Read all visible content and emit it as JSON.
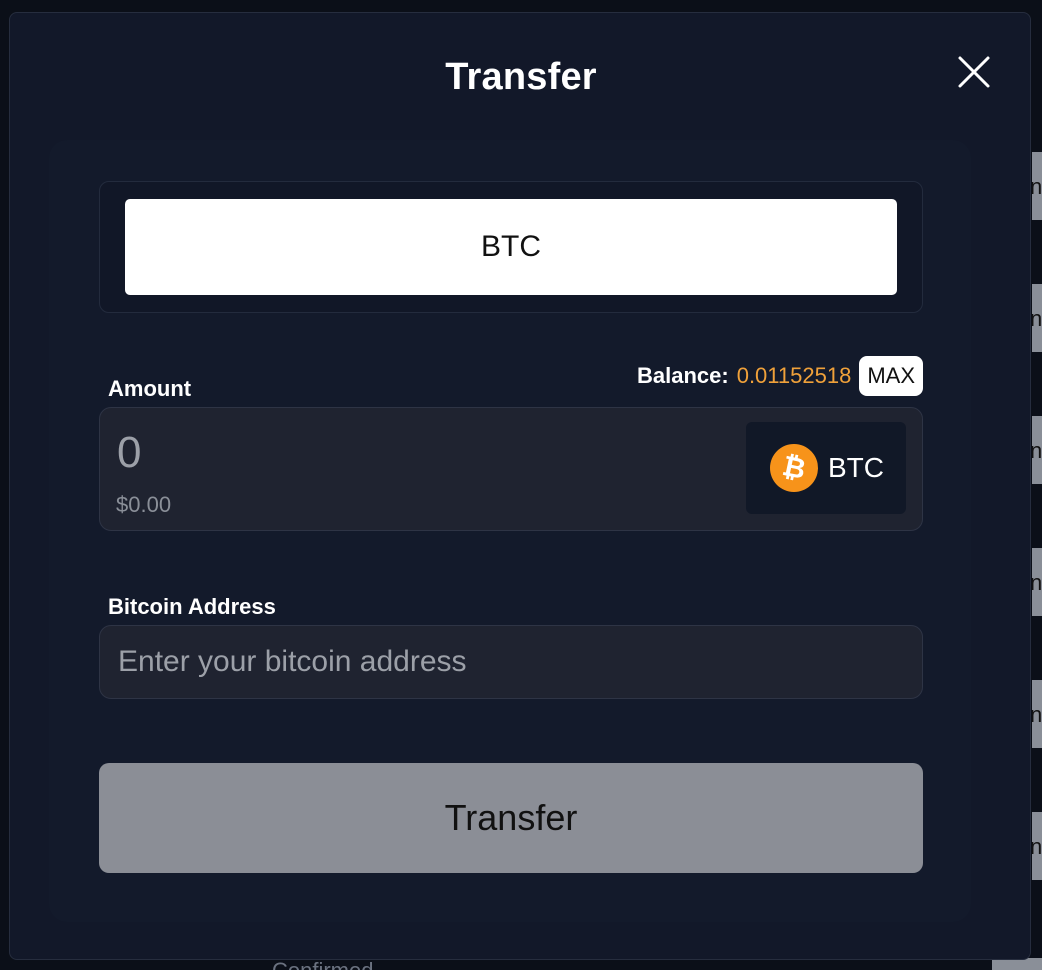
{
  "background": {
    "side_tab_fragment": "ne",
    "bottom_text_fragment": "Confirmed"
  },
  "modal": {
    "title": "Transfer",
    "close_icon": "close-icon"
  },
  "currency_selector": {
    "selected": "BTC"
  },
  "amount": {
    "label": "Amount",
    "balance_label": "Balance:",
    "balance_value": "0.01152518",
    "max_label": "MAX",
    "value": "0",
    "usd_value": "$0.00",
    "token_symbol": "BTC",
    "token_icon": "bitcoin-icon"
  },
  "address": {
    "label": "Bitcoin Address",
    "placeholder": "Enter your bitcoin address",
    "value": ""
  },
  "submit": {
    "label": "Transfer"
  },
  "colors": {
    "modal_bg": "#121829",
    "accent_balance": "#f0a13a",
    "bitcoin_orange": "#f7931a",
    "button_disabled": "#8b8e96"
  }
}
